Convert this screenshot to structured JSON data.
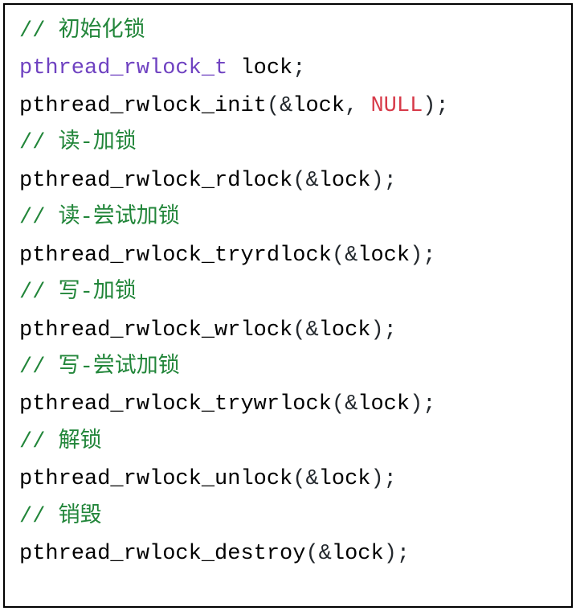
{
  "code": {
    "lines": [
      {
        "segments": [
          {
            "cls": "comment",
            "text": "// 初始化锁"
          }
        ]
      },
      {
        "segments": [
          {
            "cls": "type",
            "text": "pthread_rwlock_t"
          },
          {
            "cls": "ident",
            "text": " lock"
          },
          {
            "cls": "punct",
            "text": ";"
          }
        ]
      },
      {
        "segments": [
          {
            "cls": "func",
            "text": "pthread_rwlock_init"
          },
          {
            "cls": "punct",
            "text": "("
          },
          {
            "cls": "amp",
            "text": "&"
          },
          {
            "cls": "ident",
            "text": "lock"
          },
          {
            "cls": "punct",
            "text": ", "
          },
          {
            "cls": "null",
            "text": "NULL"
          },
          {
            "cls": "punct",
            "text": ");"
          }
        ]
      },
      {
        "segments": [
          {
            "cls": "comment",
            "text": "// 读-加锁"
          }
        ]
      },
      {
        "segments": [
          {
            "cls": "func",
            "text": "pthread_rwlock_rdlock"
          },
          {
            "cls": "punct",
            "text": "("
          },
          {
            "cls": "amp",
            "text": "&"
          },
          {
            "cls": "ident",
            "text": "lock"
          },
          {
            "cls": "punct",
            "text": ");"
          }
        ]
      },
      {
        "segments": [
          {
            "cls": "comment",
            "text": "// 读-尝试加锁"
          }
        ]
      },
      {
        "segments": [
          {
            "cls": "func",
            "text": "pthread_rwlock_tryrdlock"
          },
          {
            "cls": "punct",
            "text": "("
          },
          {
            "cls": "amp",
            "text": "&"
          },
          {
            "cls": "ident",
            "text": "lock"
          },
          {
            "cls": "punct",
            "text": ");"
          }
        ]
      },
      {
        "segments": [
          {
            "cls": "comment",
            "text": "// 写-加锁"
          }
        ]
      },
      {
        "segments": [
          {
            "cls": "func",
            "text": "pthread_rwlock_wrlock"
          },
          {
            "cls": "punct",
            "text": "("
          },
          {
            "cls": "amp",
            "text": "&"
          },
          {
            "cls": "ident",
            "text": "lock"
          },
          {
            "cls": "punct",
            "text": ");"
          }
        ]
      },
      {
        "segments": [
          {
            "cls": "comment",
            "text": "// 写-尝试加锁"
          }
        ]
      },
      {
        "segments": [
          {
            "cls": "func",
            "text": "pthread_rwlock_trywrlock"
          },
          {
            "cls": "punct",
            "text": "("
          },
          {
            "cls": "amp",
            "text": "&"
          },
          {
            "cls": "ident",
            "text": "lock"
          },
          {
            "cls": "punct",
            "text": ");"
          }
        ]
      },
      {
        "segments": [
          {
            "cls": "comment",
            "text": "// 解锁"
          }
        ]
      },
      {
        "segments": [
          {
            "cls": "func",
            "text": "pthread_rwlock_unlock"
          },
          {
            "cls": "punct",
            "text": "("
          },
          {
            "cls": "amp",
            "text": "&"
          },
          {
            "cls": "ident",
            "text": "lock"
          },
          {
            "cls": "punct",
            "text": ");"
          }
        ]
      },
      {
        "segments": [
          {
            "cls": "comment",
            "text": "// 销毁"
          }
        ]
      },
      {
        "segments": [
          {
            "cls": "func",
            "text": "pthread_rwlock_destroy"
          },
          {
            "cls": "punct",
            "text": "("
          },
          {
            "cls": "amp",
            "text": "&"
          },
          {
            "cls": "ident",
            "text": "lock"
          },
          {
            "cls": "punct",
            "text": ");"
          }
        ]
      }
    ]
  }
}
